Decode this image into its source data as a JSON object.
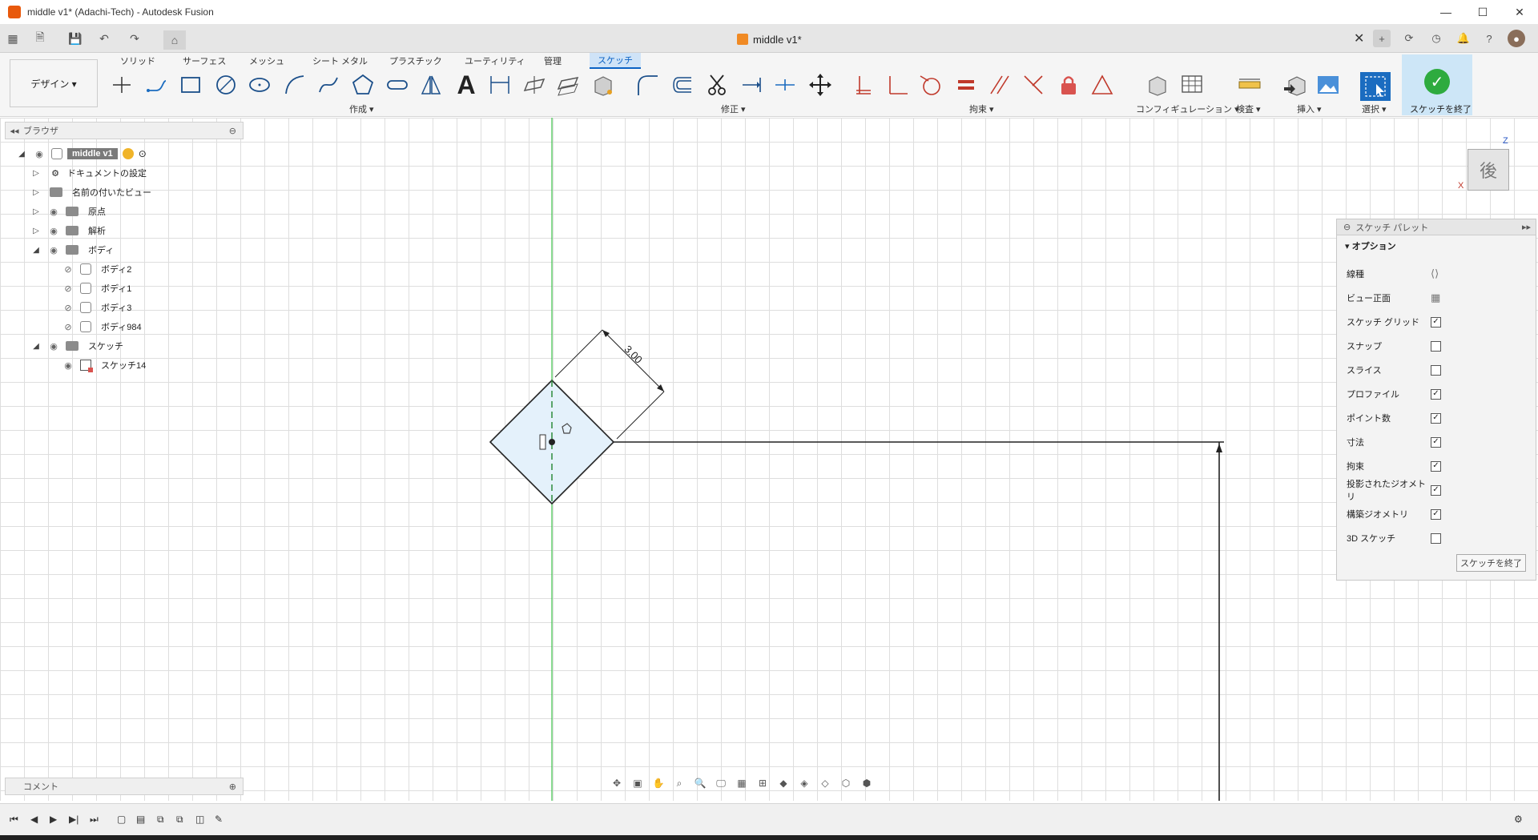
{
  "window": {
    "title": "middle v1* (Adachi-Tech) - Autodesk Fusion",
    "document_tab": "middle v1*"
  },
  "ribbon": {
    "workspace": "デザイン ▾",
    "tabs": [
      "ソリッド",
      "サーフェス",
      "メッシュ",
      "シート メタル",
      "プラスチック",
      "ユーティリティ",
      "管理",
      "スケッチ"
    ],
    "active_tab": "スケッチ",
    "groups": {
      "create": "作成 ▾",
      "modify": "修正 ▾",
      "constraints": "拘束 ▾",
      "configuration": "コンフィギュレーション ▾",
      "inspect": "検査 ▾",
      "insert": "挿入 ▾",
      "select": "選択 ▾",
      "finish": "スケッチを終了 ▾"
    }
  },
  "browser": {
    "title": "ブラウザ",
    "root": "middle v1",
    "items": {
      "doc_settings": "ドキュメントの設定",
      "named_views": "名前の付いたビュー",
      "origin": "原点",
      "analysis": "解析",
      "bodies": "ボディ",
      "body2": "ボディ2",
      "body1": "ボディ1",
      "body3": "ボディ3",
      "body984": "ボディ984",
      "sketches": "スケッチ",
      "sketch14": "スケッチ14"
    }
  },
  "canvas": {
    "dimension": "3.00"
  },
  "viewcube": {
    "face": "後",
    "axis_z": "Z",
    "axis_x": "X"
  },
  "palette": {
    "title": "スケッチ パレット",
    "section": "オプション",
    "rows": [
      {
        "label": "線種",
        "checked": null
      },
      {
        "label": "ビュー正面",
        "checked": null
      },
      {
        "label": "スケッチ グリッド",
        "checked": true
      },
      {
        "label": "スナップ",
        "checked": false
      },
      {
        "label": "スライス",
        "checked": false
      },
      {
        "label": "プロファイル",
        "checked": true
      },
      {
        "label": "ポイント数",
        "checked": true
      },
      {
        "label": "寸法",
        "checked": true
      },
      {
        "label": "拘束",
        "checked": true
      },
      {
        "label": "投影されたジオメトリ",
        "checked": true
      },
      {
        "label": "構築ジオメトリ",
        "checked": true
      },
      {
        "label": "3D スケッチ",
        "checked": false
      }
    ],
    "finish_button": "スケッチを終了"
  },
  "comments": {
    "title": "コメント"
  }
}
